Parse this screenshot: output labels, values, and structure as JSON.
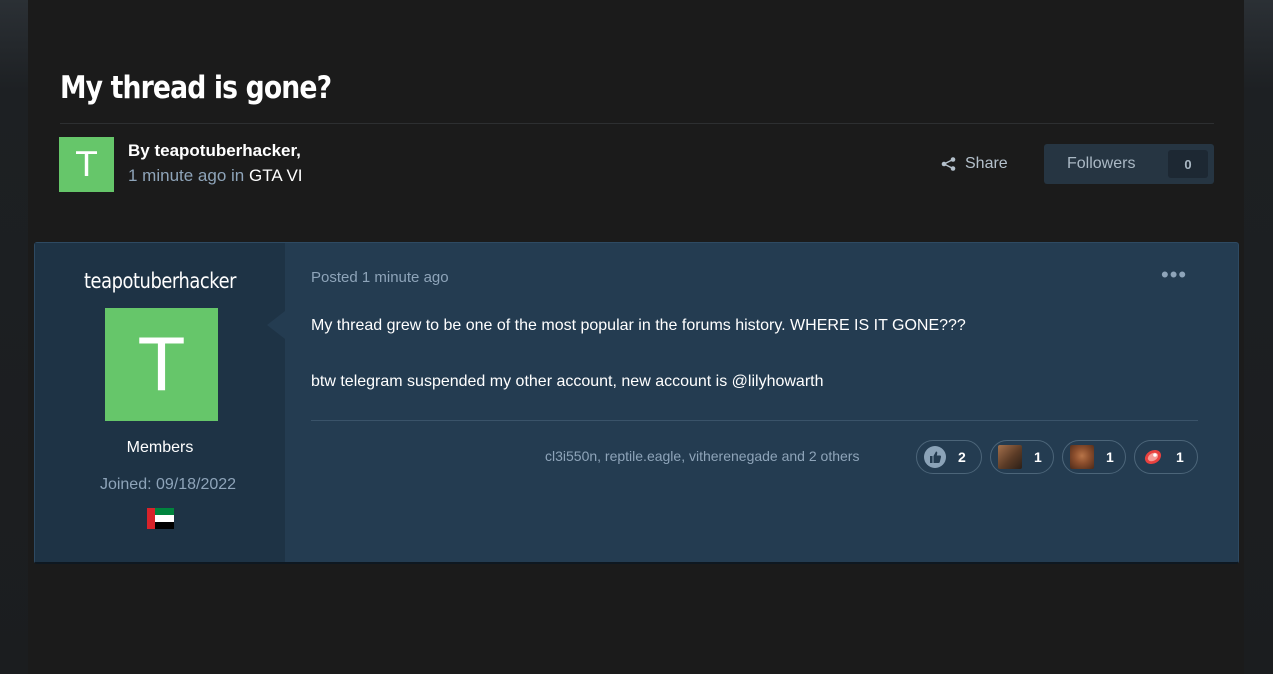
{
  "topic": {
    "title": "My thread is gone?",
    "byline": "By teapotuberhacker,",
    "time": "1 minute ago",
    "in_word": "in",
    "forum": "GTA VI",
    "avatar_letter": "T",
    "share_label": "Share",
    "followers_label": "Followers",
    "followers_count": "0"
  },
  "post": {
    "author": {
      "name": "teapotuberhacker",
      "avatar_letter": "T",
      "group": "Members",
      "joined": "Joined: 09/18/2022",
      "flag_icon": "uae-flag-icon"
    },
    "posted": "Posted 1 minute ago",
    "more_label": "•••",
    "lines": [
      "My thread grew to be one of the most popular in the forums history. WHERE IS IT GONE???",
      "btw telegram suspended my other account, new account is @lilyhowarth"
    ],
    "reacted_by": "cl3i550n, reptile.eagle, vitherenegade and 2 others",
    "reactions": [
      {
        "icon": "thumbs-up-icon",
        "count": "2"
      },
      {
        "icon": "meme-image-icon",
        "count": "1"
      },
      {
        "icon": "face-image-icon",
        "count": "1"
      },
      {
        "icon": "steak-icon",
        "count": "1"
      }
    ]
  },
  "colors": {
    "accent_green": "#66c66a",
    "post_bg": "#243c51",
    "author_panel_bg": "#1e3345"
  }
}
